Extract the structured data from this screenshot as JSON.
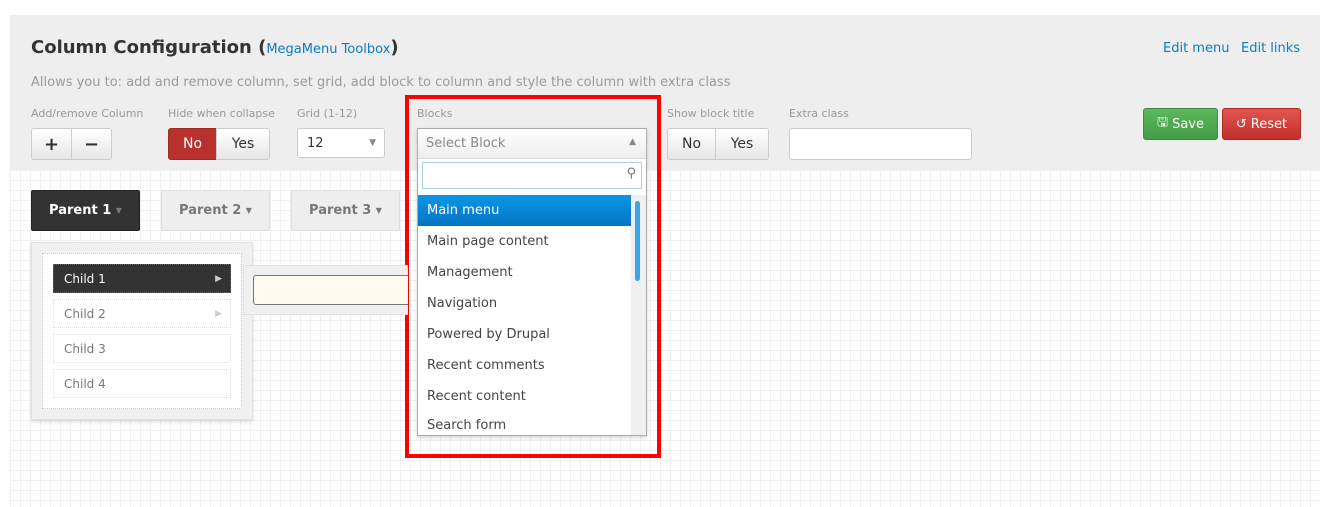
{
  "header": {
    "title": "Column Configuration",
    "toolbox_link": "MegaMenu Toolbox",
    "description": "Allows you to: add and remove column, set grid, add block to column and style the column with extra class",
    "links": [
      "Edit menu",
      "Edit links"
    ]
  },
  "controls": {
    "add_remove_label": "Add/remove Column",
    "add": "+",
    "remove": "−",
    "hide_label": "Hide when collapse",
    "hide_no": "No",
    "hide_yes": "Yes",
    "hide_selected": "No",
    "grid_label": "Grid (1-12)",
    "grid_value": "12",
    "blocks_label": "Blocks",
    "blocks_placeholder": "Select Block",
    "show_title_label": "Show block title",
    "show_no": "No",
    "show_yes": "Yes",
    "extra_label": "Extra class",
    "extra_value": "",
    "save": "Save",
    "reset": "Reset"
  },
  "blocks_options": [
    "Main menu",
    "Main page content",
    "Management",
    "Navigation",
    "Powered by Drupal",
    "Recent comments",
    "Recent content",
    "Search form"
  ],
  "blocks_highlighted": "Main menu",
  "menu": {
    "parents": [
      "Parent 1",
      "Parent 2",
      "Parent 3"
    ],
    "children": [
      "Child 1",
      "Child 2",
      "Child 3",
      "Child 4"
    ]
  },
  "colors": {
    "accent": "#0a7cc1",
    "danger": "#b8312d",
    "success": "#4cae4c",
    "highlight_box": "#ff0000"
  }
}
